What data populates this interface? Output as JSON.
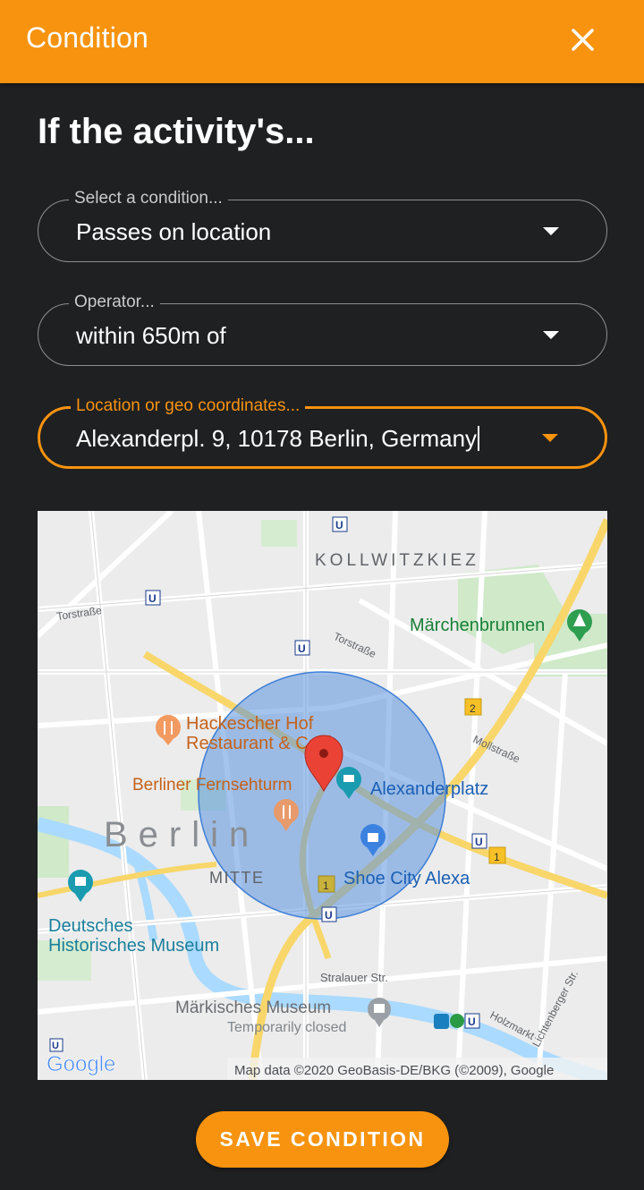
{
  "header": {
    "title": "Condition"
  },
  "form": {
    "heading": "If the activity's...",
    "condition": {
      "legend": "Select a condition...",
      "value": "Passes on location"
    },
    "operator": {
      "legend": "Operator...",
      "value": "within 650m of"
    },
    "location": {
      "legend": "Location or geo coordinates...",
      "value": "Alexanderpl. 9, 10178 Berlin, Germany"
    }
  },
  "map": {
    "labels": {
      "kollwitzkiez": "KOLLWITZKIEZ",
      "torstrasse1": "Torstraße",
      "torstrasse2": "Torstraße",
      "maerchenbrunnen": "Märchenbrunnen",
      "hackescher1": "Hackescher Hof",
      "hackescher2": "Restaurant & Café",
      "fernsehturm": "Berliner Fernsehturm",
      "alexanderplatz": "Alexanderplatz",
      "mollstrasse": "Mollstraße",
      "berlin": "Berlin",
      "mitte": "MITTE",
      "shoecity": "Shoe City Alexa",
      "dhm1": "Deutsches",
      "dhm2": "Historisches Museum",
      "stralauer": "Stralauer Str.",
      "maerkisches": "Märkisches Museum",
      "closed": "Temporarily closed",
      "holzmarkt": "Holzmarkt",
      "lichtenberger": "Lichtenberger Str.",
      "google": "Google",
      "attribution": "Map data ©2020 GeoBasis-DE/BKG (©2009), Google",
      "route2": "2",
      "route1a": "1",
      "route1b": "1",
      "ubahn": "U"
    },
    "colors": {
      "background": "#ececec",
      "road": "#ffffff",
      "major_road": "#f8d66a",
      "water": "#aadaff",
      "park": "#c5e8c5",
      "radius": "#5a93e0",
      "pin": "#ea4335"
    }
  },
  "footer": {
    "save_label": "SAVE CONDITION"
  },
  "colors": {
    "accent": "#f7930f",
    "background": "#1f2022",
    "border": "#8e8f93"
  }
}
